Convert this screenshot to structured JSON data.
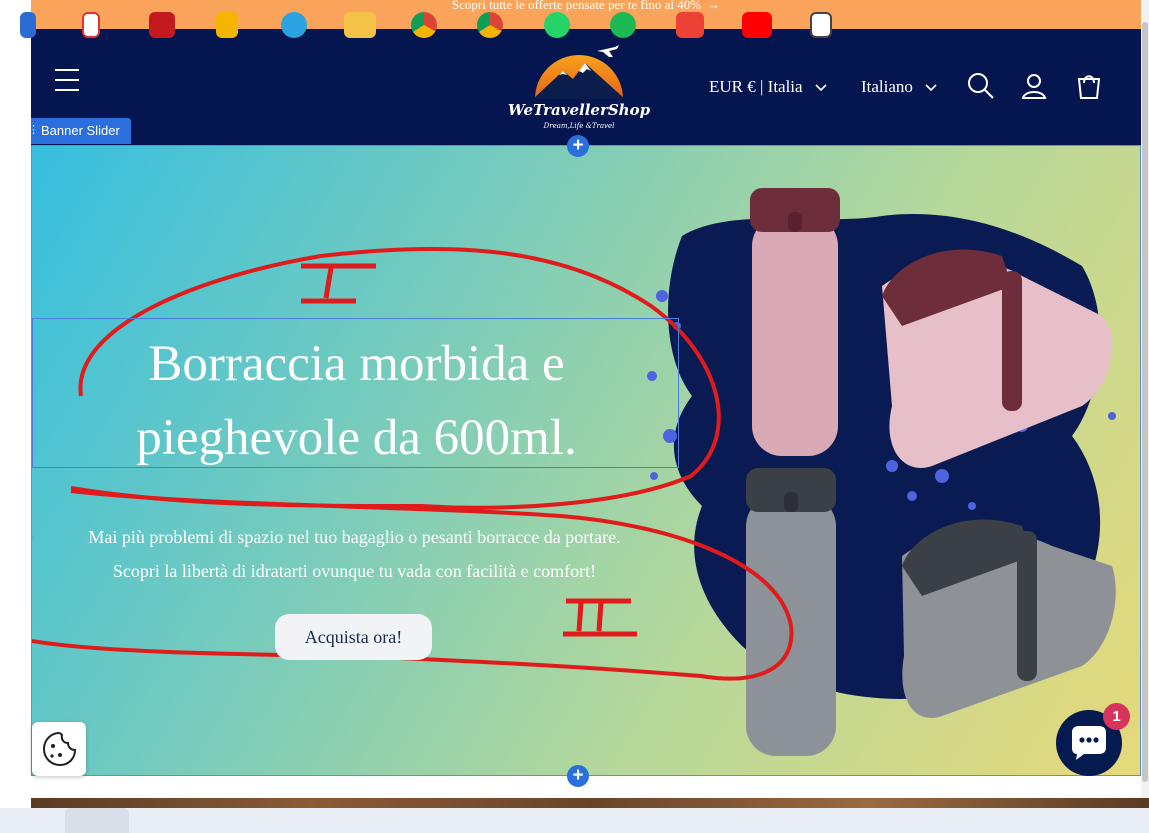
{
  "announcement": {
    "text": "Scopri tutte le offerte pensate per te fino al 40%",
    "arrow": "→"
  },
  "header": {
    "menu_icon": "hamburger-menu-icon",
    "logo": {
      "title": "WeTravellerShop",
      "tagline": "Dream,Life &Travel"
    },
    "currency": {
      "label": "EUR € | Italia",
      "chevron": "⌄"
    },
    "language": {
      "label": "Italiano",
      "chevron": "⌄"
    },
    "icons": [
      "search-icon",
      "account-icon",
      "cart-icon"
    ]
  },
  "editor": {
    "section_label": "Banner Slider",
    "add_icon": "+"
  },
  "hero": {
    "headline_line1": "Borraccia morbida e",
    "headline_line2": "pieghevole da 600ml.",
    "sub_line1": "Mai più problemi di spazio nel tuo bagaglio o pesanti borracce da portare.",
    "sub_line2": "Scopri la libertà di idratarti ovunque tu vada con facilità e comfort!",
    "cta_label": "Acquista ora!"
  },
  "annotations": {
    "mark1": "I",
    "mark2": "II",
    "stroke_color": "#e01b1b"
  },
  "chat": {
    "badge_count": "1",
    "icon": "chat-icon"
  },
  "cookie": {
    "icon": "cookie-icon"
  },
  "colors": {
    "announcement_bg": "#f9a45a",
    "header_bg": "#04154f",
    "editor_blue": "#2a6fdb",
    "badge": "#d6345a"
  },
  "taskbar": {
    "icons": [
      "windows-icon",
      "document-icon",
      "pdf-icon",
      "file-icon",
      "telegram-icon",
      "folder-icon",
      "chrome-icon",
      "chrome-profile-icon",
      "whatsapp-icon",
      "spotify-icon",
      "gmail-icon",
      "youtube-icon",
      "notes-icon"
    ]
  }
}
